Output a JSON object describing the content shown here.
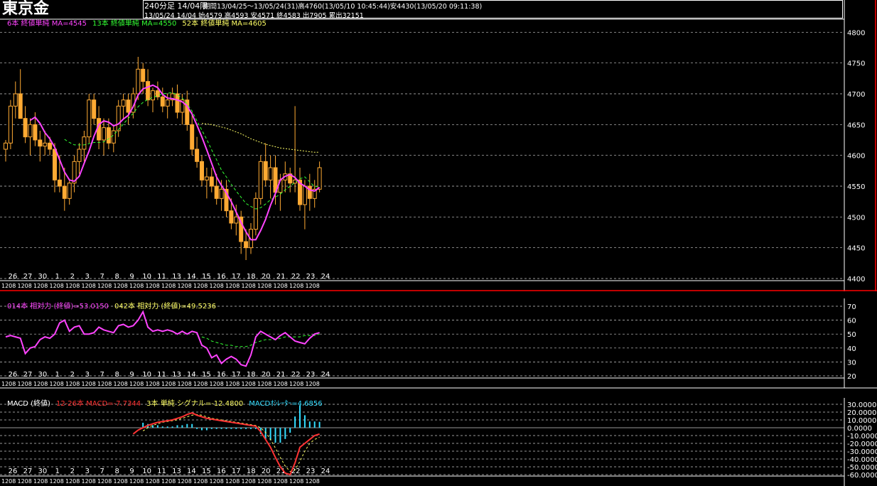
{
  "header": {
    "title": "東京金",
    "period_label": "240分足 14/04限",
    "range_text": "期間13/04/25～13/05/24(31)高4760(13/05/10 10:45:44)安4430(13/05/20 09:11:38)",
    "last_bar_text": "13/05/24 14/04 始4579 高4593 安4571 終4583 出7905 累出32151"
  },
  "legends": {
    "price": [
      {
        "text": "6本 終値単純 MA=4545",
        "color": "#ff44ff"
      },
      {
        "text": "13本 終値単純 MA=4550",
        "color": "#33ff33"
      },
      {
        "text": "52本 終値単純 MA=4605",
        "color": "#ffff66"
      }
    ],
    "rsi": [
      {
        "text": "014本 相対力 (終値)=53.0150",
        "color": "#ff44ff"
      },
      {
        "text": "042本 相対力 (終値)=49.5236",
        "color": "#ffff66"
      }
    ],
    "macd": [
      {
        "text": "MACD (終値)",
        "color": "#ffffff"
      },
      {
        "text": "12-26本 MACD=-7.7344",
        "color": "#ff3333"
      },
      {
        "text": "3本 単純 シグナル=-12.4800",
        "color": "#ffff66"
      },
      {
        "text": "MACDｵｼﾚｰﾀｰ=4.6856",
        "color": "#33ddff"
      }
    ]
  },
  "colors": {
    "candle": "#ffaa33",
    "ma6": "#ff44ff",
    "ma13": "#33ff33",
    "ma52": "#ffff66",
    "rsi14": "#ff44ff",
    "rsi42": "#33ff33",
    "macd": "#ff3333",
    "signal": "#ffff66",
    "osc": "#33ddff",
    "grid": "#ffffff",
    "separator": "#ff0000"
  },
  "chart_data": [
    {
      "type": "candlestick",
      "title": "東京金 240分足",
      "ylim": [
        4400,
        4820
      ],
      "yticks": [
        "4800",
        "4750",
        "4700",
        "4650",
        "4600",
        "4550",
        "4500",
        "4450",
        "4400"
      ],
      "x_day_labels": [
        "26",
        "27",
        "30",
        "1",
        "2",
        "3",
        "7",
        "8",
        "9",
        "10",
        "11",
        "13",
        "14",
        "15",
        "16",
        "17",
        "18",
        "20",
        "21",
        "22",
        "23",
        "24"
      ],
      "x_sub_label": "1208",
      "ohlc": [
        [
          4610,
          4625,
          4590,
          4620
        ],
        [
          4620,
          4690,
          4610,
          4680
        ],
        [
          4680,
          4720,
          4660,
          4700
        ],
        [
          4700,
          4740,
          4680,
          4660
        ],
        [
          4660,
          4680,
          4620,
          4630
        ],
        [
          4630,
          4660,
          4600,
          4650
        ],
        [
          4650,
          4670,
          4615,
          4625
        ],
        [
          4625,
          4640,
          4590,
          4615
        ],
        [
          4615,
          4640,
          4600,
          4620
        ],
        [
          4620,
          4630,
          4600,
          4610
        ],
        [
          4610,
          4620,
          4540,
          4560
        ],
        [
          4560,
          4600,
          4540,
          4550
        ],
        [
          4550,
          4580,
          4510,
          4530
        ],
        [
          4530,
          4560,
          4520,
          4555
        ],
        [
          4555,
          4600,
          4540,
          4590
        ],
        [
          4590,
          4620,
          4570,
          4610
        ],
        [
          4610,
          4640,
          4590,
          4630
        ],
        [
          4630,
          4700,
          4620,
          4690
        ],
        [
          4690,
          4700,
          4650,
          4660
        ],
        [
          4660,
          4680,
          4610,
          4625
        ],
        [
          4625,
          4660,
          4600,
          4645
        ],
        [
          4645,
          4660,
          4610,
          4620
        ],
        [
          4620,
          4650,
          4605,
          4640
        ],
        [
          4640,
          4690,
          4630,
          4680
        ],
        [
          4680,
          4700,
          4660,
          4690
        ],
        [
          4690,
          4700,
          4650,
          4670
        ],
        [
          4670,
          4710,
          4660,
          4700
        ],
        [
          4700,
          4760,
          4690,
          4740
        ],
        [
          4740,
          4750,
          4700,
          4720
        ],
        [
          4720,
          4740,
          4680,
          4690
        ],
        [
          4690,
          4710,
          4670,
          4705
        ],
        [
          4705,
          4720,
          4690,
          4695
        ],
        [
          4695,
          4710,
          4670,
          4680
        ],
        [
          4680,
          4700,
          4660,
          4690
        ],
        [
          4690,
          4710,
          4680,
          4700
        ],
        [
          4700,
          4715,
          4660,
          4670
        ],
        [
          4670,
          4700,
          4650,
          4690
        ],
        [
          4690,
          4705,
          4640,
          4650
        ],
        [
          4650,
          4670,
          4600,
          4610
        ],
        [
          4610,
          4630,
          4580,
          4590
        ],
        [
          4590,
          4600,
          4550,
          4560
        ],
        [
          4560,
          4580,
          4530,
          4565
        ],
        [
          4565,
          4580,
          4540,
          4550
        ],
        [
          4550,
          4570,
          4520,
          4530
        ],
        [
          4530,
          4560,
          4510,
          4545
        ],
        [
          4545,
          4560,
          4500,
          4510
        ],
        [
          4510,
          4530,
          4480,
          4490
        ],
        [
          4490,
          4520,
          4470,
          4500
        ],
        [
          4500,
          4510,
          4440,
          4460
        ],
        [
          4460,
          4480,
          4430,
          4450
        ],
        [
          4450,
          4490,
          4440,
          4480
        ],
        [
          4480,
          4540,
          4470,
          4530
        ],
        [
          4530,
          4600,
          4520,
          4590
        ],
        [
          4590,
          4620,
          4550,
          4560
        ],
        [
          4560,
          4600,
          4530,
          4580
        ],
        [
          4580,
          4600,
          4520,
          4540
        ],
        [
          4540,
          4570,
          4510,
          4560
        ],
        [
          4560,
          4590,
          4540,
          4570
        ],
        [
          4570,
          4580,
          4540,
          4555
        ],
        [
          4555,
          4680,
          4540,
          4560
        ],
        [
          4560,
          4580,
          4510,
          4520
        ],
        [
          4520,
          4560,
          4480,
          4550
        ],
        [
          4550,
          4570,
          4510,
          4530
        ],
        [
          4530,
          4560,
          4515,
          4545
        ],
        [
          4545,
          4590,
          4540,
          4580
        ]
      ],
      "ma_series": [
        {
          "name": "6本 終値単純 MA",
          "values": [
            null,
            null,
            null,
            null,
            null,
            4657,
            4662,
            4652,
            4637,
            4627,
            4613,
            4593,
            4573,
            4560,
            4558,
            4566,
            4587,
            4607,
            4631,
            4650,
            4656,
            4654,
            4648,
            4651,
            4659,
            4665,
            4679,
            4698,
            4708,
            4711,
            4714,
            4710,
            4699,
            4693,
            4692,
            4690,
            4687,
            4680,
            4667,
            4649,
            4630,
            4609,
            4587,
            4565,
            4551,
            4539,
            4525,
            4508,
            4491,
            4476,
            4463,
            4463,
            4478,
            4496,
            4519,
            4538,
            4560,
            4566,
            4569,
            4564,
            4555,
            4550,
            4544,
            4542,
            4548
          ]
        },
        {
          "name": "13本 終値単純 MA",
          "values": [
            null,
            null,
            null,
            null,
            null,
            null,
            null,
            null,
            null,
            null,
            null,
            null,
            4626,
            4621,
            4617,
            4617,
            4617,
            4619,
            4621,
            4621,
            4622,
            4627,
            4633,
            4642,
            4651,
            4660,
            4668,
            4679,
            4686,
            4691,
            4694,
            4697,
            4700,
            4701,
            4702,
            4698,
            4693,
            4684,
            4672,
            4656,
            4641,
            4626,
            4609,
            4593,
            4576,
            4565,
            4553,
            4542,
            4532,
            4522,
            4517,
            4513,
            4515,
            4521,
            4528,
            4532,
            4537,
            4544,
            4550,
            4556,
            4562,
            4565,
            4557,
            4549,
            4550
          ]
        },
        {
          "name": "52本 終値単純 MA",
          "values": [
            null,
            null,
            null,
            null,
            null,
            null,
            null,
            null,
            null,
            null,
            null,
            null,
            null,
            null,
            null,
            null,
            null,
            null,
            null,
            null,
            null,
            null,
            null,
            null,
            null,
            null,
            null,
            null,
            null,
            null,
            null,
            null,
            null,
            null,
            null,
            null,
            null,
            null,
            null,
            null,
            4652,
            4651,
            4650,
            4648,
            4646,
            4644,
            4641,
            4638,
            4635,
            4631,
            4627,
            4624,
            4621,
            4618,
            4616,
            4614,
            4612,
            4611,
            4610,
            4609,
            4608,
            4607,
            4606,
            4605,
            4605
          ]
        }
      ]
    },
    {
      "type": "line",
      "title": "相対力",
      "ylim": [
        20,
        70
      ],
      "yticks": [
        "70",
        "60",
        "50",
        "40",
        "30",
        "20"
      ],
      "series": [
        {
          "name": "014本 相対力 (終値)",
          "values": [
            48,
            49,
            48,
            47,
            36,
            40,
            41,
            46,
            48,
            47,
            50,
            58,
            60,
            52,
            55,
            56,
            50,
            50,
            51,
            55,
            53,
            52,
            51,
            56,
            57,
            55,
            56,
            60,
            66,
            55,
            52,
            53,
            52,
            53,
            52,
            50,
            52,
            50,
            52,
            51,
            42,
            40,
            33,
            35,
            29,
            32,
            34,
            32,
            28,
            27,
            35,
            48,
            52,
            50,
            48,
            46,
            49,
            51,
            48,
            45,
            44,
            43,
            47,
            50,
            51
          ]
        },
        {
          "name": "042本 相対力 (終値)",
          "values": [
            null,
            null,
            null,
            null,
            null,
            null,
            null,
            null,
            null,
            null,
            null,
            null,
            null,
            null,
            null,
            null,
            null,
            null,
            null,
            null,
            null,
            null,
            null,
            null,
            null,
            null,
            null,
            null,
            null,
            null,
            null,
            null,
            null,
            null,
            null,
            null,
            null,
            null,
            null,
            null,
            48,
            47,
            45,
            44,
            43,
            42,
            42,
            41,
            41,
            41,
            42,
            44,
            45,
            46,
            46,
            46,
            47,
            48,
            48,
            48,
            48,
            49,
            49,
            49,
            50
          ]
        }
      ]
    },
    {
      "type": "line",
      "title": "MACD",
      "ylim": [
        -60,
        30
      ],
      "yticks": [
        "30.0000",
        "20.0000",
        "10.0000",
        "0.0000",
        "-10.0000",
        "-20.0000",
        "-30.0000",
        "-40.0000",
        "-50.0000",
        "-60.0000"
      ],
      "series": [
        {
          "name": "12-26本 MACD",
          "values": [
            null,
            null,
            null,
            null,
            null,
            null,
            null,
            null,
            null,
            null,
            null,
            null,
            null,
            null,
            null,
            null,
            null,
            null,
            null,
            null,
            null,
            null,
            null,
            null,
            null,
            null,
            -8,
            -3,
            0,
            3,
            5,
            7,
            8,
            9,
            10,
            12,
            14,
            17,
            19,
            16,
            14,
            12,
            11,
            10,
            9,
            8,
            7,
            6,
            5,
            4,
            3,
            2,
            -5,
            -15,
            -25,
            -38,
            -50,
            -58,
            -60,
            -45,
            -25,
            -20,
            -15,
            -10,
            -8
          ]
        },
        {
          "name": "3本 単純 シグナル",
          "values": [
            null,
            null,
            null,
            null,
            null,
            null,
            null,
            null,
            null,
            null,
            null,
            null,
            null,
            null,
            null,
            null,
            null,
            null,
            null,
            null,
            null,
            null,
            null,
            null,
            null,
            null,
            null,
            null,
            -4,
            0,
            3,
            5,
            7,
            8,
            9,
            10,
            12,
            14,
            16,
            17,
            16,
            14,
            12,
            11,
            10,
            9,
            8,
            7,
            6,
            5,
            4,
            3,
            0,
            -6,
            -15,
            -26,
            -38,
            -49,
            -56,
            -54,
            -43,
            -30,
            -20,
            -15,
            -12
          ]
        },
        {
          "name": "MACDｵｼﾚｰﾀｰ",
          "values": [
            null,
            null,
            null,
            null,
            null,
            null,
            null,
            null,
            null,
            null,
            null,
            null,
            null,
            null,
            null,
            null,
            null,
            null,
            null,
            null,
            null,
            null,
            null,
            null,
            null,
            null,
            null,
            null,
            4,
            3,
            2,
            2,
            1,
            1,
            1,
            2,
            2,
            3,
            3,
            -1,
            -2,
            -2,
            -1,
            -1,
            -1,
            -1,
            -1,
            -1,
            -1,
            -1,
            -1,
            -1,
            -5,
            -9,
            -10,
            -12,
            -12,
            -9,
            -4,
            9,
            18,
            10,
            5,
            5,
            4.7
          ]
        }
      ]
    }
  ]
}
